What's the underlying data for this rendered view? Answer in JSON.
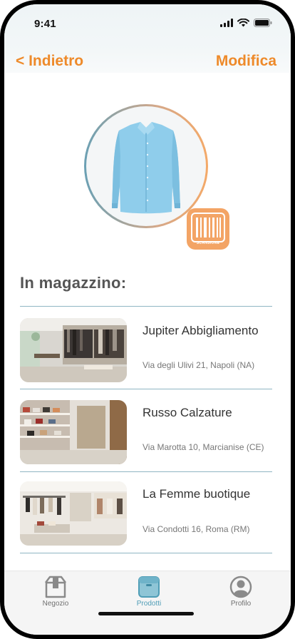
{
  "status_bar": {
    "time": "9:41"
  },
  "nav": {
    "back_label": "< Indietro",
    "edit_label": "Modifica"
  },
  "product": {
    "scan_label": "SCANSIONE"
  },
  "stock": {
    "title": "In magazzino:",
    "stores": [
      {
        "name": "Jupiter Abbigliamento",
        "address": "Via degli Ulivi 21, Napoli (NA)"
      },
      {
        "name": "Russo Calzature",
        "address": "Via Marotta 10, Marcianise (CE)"
      },
      {
        "name": "La Femme buotique",
        "address": "Via Condotti 16, Roma (RM)"
      }
    ]
  },
  "tabbar": {
    "tabs": [
      {
        "label": "Negozio",
        "icon": "store-icon"
      },
      {
        "label": "Prodotti",
        "icon": "box-icon"
      },
      {
        "label": "Profilo",
        "icon": "profile-icon"
      }
    ],
    "active": "Prodotti"
  },
  "colors": {
    "accent": "#ee8a2a",
    "active_tab": "#4f9db6",
    "divider": "#8fb6c3"
  }
}
